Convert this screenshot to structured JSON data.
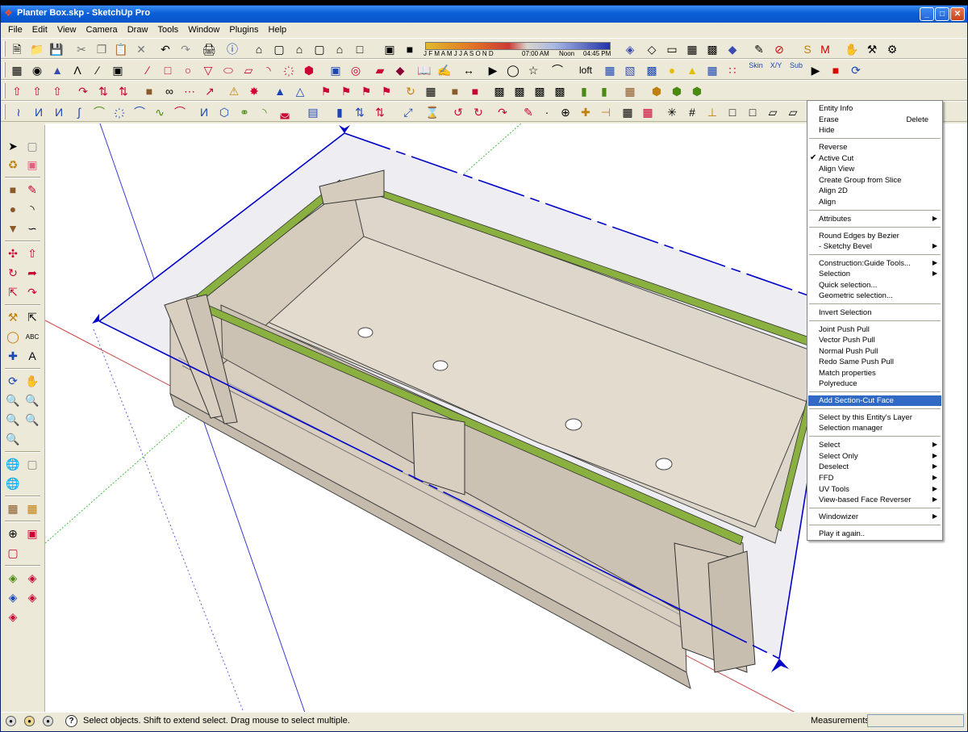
{
  "window": {
    "title": "Planter Box.skp - SketchUp Pro"
  },
  "menu": [
    "File",
    "Edit",
    "View",
    "Camera",
    "Draw",
    "Tools",
    "Window",
    "Plugins",
    "Help"
  ],
  "toolbar": {
    "shadow_months": "J F M A M J J A S O N D",
    "shadow_start_time": "07:00 AM",
    "shadow_noon": "Noon",
    "shadow_end_time": "04:45 PM",
    "loft_label": "loft",
    "skin_label": "Skin",
    "xy_label": "X/Y",
    "sub_label": "Sub"
  },
  "context_menu": {
    "items": [
      {
        "label": "Entity Info"
      },
      {
        "label": "Erase",
        "accelerator": "Delete"
      },
      {
        "label": "Hide"
      },
      {
        "label": "Reverse"
      },
      {
        "label": "Active Cut",
        "checked": true
      },
      {
        "label": "Align View"
      },
      {
        "label": "Create Group from Slice"
      },
      {
        "label": "Align 2D"
      },
      {
        "label": "Align"
      },
      {
        "label": "Attributes",
        "submenu": true
      },
      {
        "label": "Round Edges by Bezier"
      },
      {
        "label": "- Sketchy Bevel",
        "submenu": true
      },
      {
        "label": "Construction:Guide Tools...",
        "submenu": true
      },
      {
        "label": "Selection",
        "submenu": true
      },
      {
        "label": "Quick selection..."
      },
      {
        "label": "Geometric selection..."
      },
      {
        "label": "Invert Selection"
      },
      {
        "label": "Joint Push Pull"
      },
      {
        "label": "Vector Push Pull"
      },
      {
        "label": "Normal Push Pull"
      },
      {
        "label": "Redo Same Push Pull"
      },
      {
        "label": "Match properties"
      },
      {
        "label": "Polyreduce"
      },
      {
        "label": "Add Section-Cut Face",
        "highlighted": true
      },
      {
        "label": "Select by this Entity's Layer"
      },
      {
        "label": "Selection manager"
      },
      {
        "label": "Select",
        "submenu": true
      },
      {
        "label": "Select Only",
        "submenu": true
      },
      {
        "label": "Deselect",
        "submenu": true
      },
      {
        "label": "FFD",
        "submenu": true
      },
      {
        "label": "UV Tools",
        "submenu": true
      },
      {
        "label": "View-based Face Reverser",
        "submenu": true
      },
      {
        "label": "Windowizer",
        "submenu": true
      },
      {
        "label": "Play it again.."
      }
    ]
  },
  "status": {
    "help_icon": "question-icon",
    "text": "Select objects. Shift to extend select. Drag mouse to select multiple.",
    "measurements_label": "Measurements",
    "measurements_value": ""
  },
  "colors": {
    "selection_blue": "#0000c8",
    "board_face": "#d9d0c2",
    "board_shade": "#c6bcae",
    "section_cut_green": "#8ab040",
    "menu_highlight": "#316ac5"
  }
}
